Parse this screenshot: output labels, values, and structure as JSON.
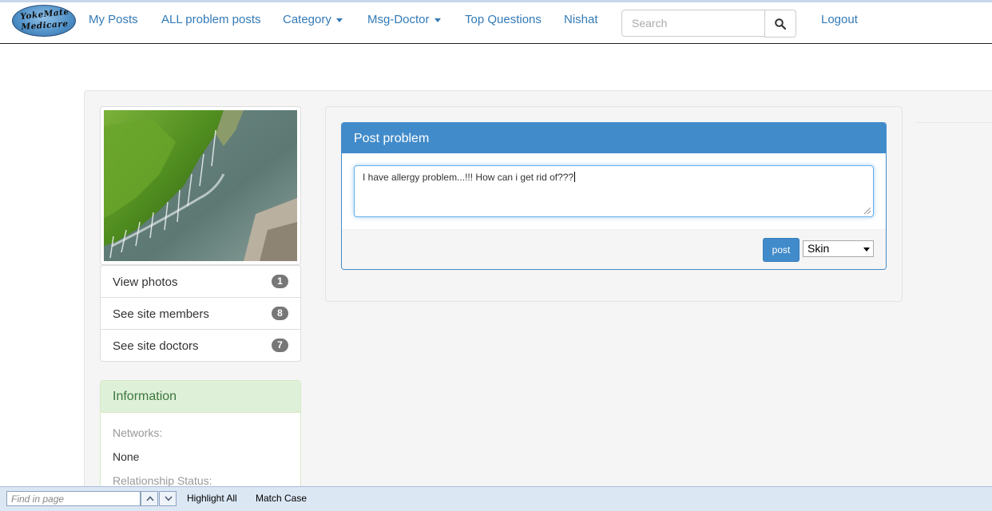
{
  "brand": {
    "line1": "YokeMate",
    "line2": "Medicare"
  },
  "nav": {
    "my_posts": "My Posts",
    "all_problem_posts": "ALL problem posts",
    "category": "Category",
    "msg_doctor": "Msg-Doctor",
    "top_questions": "Top Questions",
    "user_name": "Nishat",
    "logout": "Logout"
  },
  "search": {
    "placeholder": "Search",
    "button_icon": "search-icon"
  },
  "sidebar": {
    "photo_icon": "waterfall-photo",
    "items": [
      {
        "label": "View photos",
        "count": "1"
      },
      {
        "label": "See site members",
        "count": "8"
      },
      {
        "label": "See site doctors",
        "count": "7"
      }
    ]
  },
  "info_panel": {
    "title": "Information",
    "networks_label": "Networks:",
    "networks_value": "None",
    "relationship_label": "Relationship Status:"
  },
  "post_panel": {
    "title": "Post problem",
    "textarea_value": "I have allergy problem...!!! How can i get rid of???",
    "post_button": "post",
    "category_selected": "Skin"
  },
  "find_bar": {
    "placeholder": "Find in page",
    "highlight_all": "Highlight All",
    "match_case": "Match Case"
  },
  "colors": {
    "primary": "#428bca",
    "link": "#337ab7",
    "info_green": "#3c763d",
    "badge": "#777777"
  }
}
